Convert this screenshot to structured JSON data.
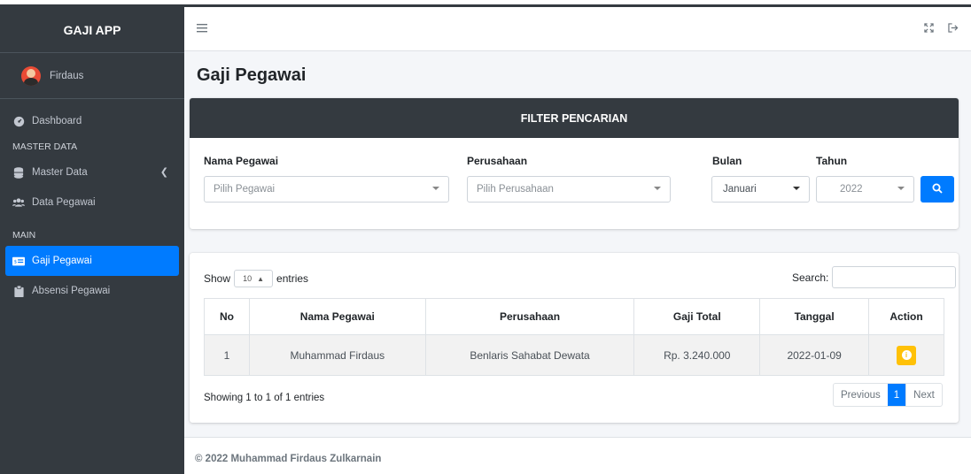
{
  "app": {
    "brand": "GAJI APP",
    "user_name": "Firdaus"
  },
  "sidebar": {
    "dashboard": "Dashboard",
    "section_master": "MASTER DATA",
    "master_data": "Master Data",
    "data_pegawai": "Data Pegawai",
    "section_main": "MAIN",
    "gaji_pegawai": "Gaji Pegawai",
    "absensi_pegawai": "Absensi Pegawai"
  },
  "page": {
    "title": "Gaji Pegawai"
  },
  "filter": {
    "header": "FILTER PENCARIAN",
    "nama_label": "Nama Pegawai",
    "nama_placeholder": "Pilih Pegawai",
    "perusahaan_label": "Perusahaan",
    "perusahaan_placeholder": "Pilih Perusahaan",
    "bulan_label": "Bulan",
    "bulan_value": "Januari",
    "tahun_label": "Tahun",
    "tahun_value": "2022"
  },
  "table_controls": {
    "show": "Show",
    "entries_value": "10",
    "entries": "entries",
    "search_label": "Search:"
  },
  "table": {
    "headers": [
      "No",
      "Nama Pegawai",
      "Perusahaan",
      "Gaji Total",
      "Tanggal",
      "Action"
    ],
    "rows": [
      [
        "1",
        "Muhammad Firdaus",
        "Benlaris Sahabat Dewata",
        "Rp. 3.240.000",
        "2022-01-09"
      ]
    ]
  },
  "pagination": {
    "info": "Showing 1 to 1 of 1 entries",
    "previous": "Previous",
    "current": "1",
    "next": "Next"
  },
  "footer": {
    "text": "© 2022 Muhammad Firdaus Zulkarnain"
  },
  "colors": {
    "sidebar": "#343a40",
    "primary": "#007bff",
    "warning": "#ffc107"
  }
}
